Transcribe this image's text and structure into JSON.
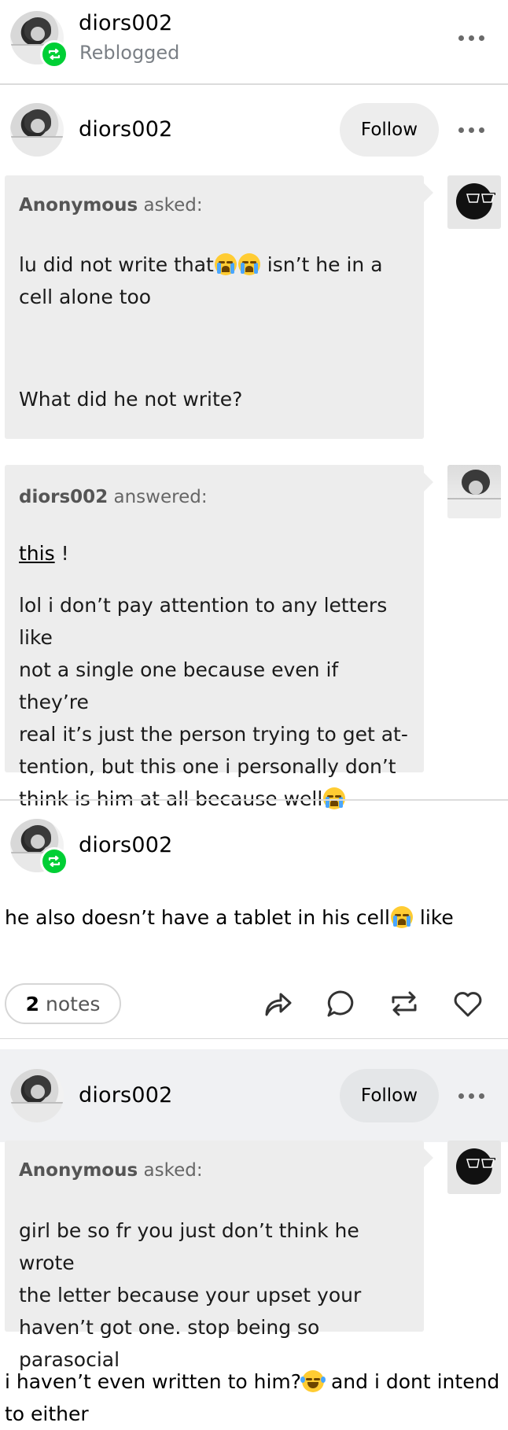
{
  "reblog_header": {
    "username": "diors002",
    "status": "Reblogged"
  },
  "post1": {
    "username": "diors002",
    "follow_label": "Follow",
    "ask": {
      "asker": "Anonymous",
      "asked_label": "asked:",
      "question_line1": "lu did not write that",
      "question_line1_after": "isn’t he in a",
      "question_line2": "cell alone too",
      "followup": "What did he not write?"
    },
    "answer": {
      "answerer": "diors002",
      "answered_label": "answered:",
      "link_text": "this",
      "link_after": " !",
      "body_lines": [
        "lol i don’t pay attention to any letters like",
        "not a single one because even if they’re",
        "real it’s just the person trying to get at-",
        "tention, but this one i personally don’t",
        "think is him at all because well"
      ]
    }
  },
  "post2": {
    "username": "diors002",
    "text": "he also doesn’t have a tablet in his cell",
    "text_after": " like"
  },
  "footer": {
    "notes_count": "2",
    "notes_label": "notes",
    "actions": [
      "share-icon",
      "reply-icon",
      "reblog-icon",
      "like-icon"
    ]
  },
  "post3": {
    "username": "diors002",
    "follow_label": "Follow",
    "ask": {
      "asker": "Anonymous",
      "asked_label": "asked:",
      "lines": [
        "girl be so fr you just don’t think he wrote",
        "the letter because your upset your",
        "haven’t got one. stop being so parasocial"
      ]
    },
    "reply_line1": "i haven’t even written to him?",
    "reply_line1_after": " and i dont intend",
    "reply_line2": "to either"
  },
  "colors": {
    "reblog_green": "#00cf35",
    "bubble_bg": "#ededed",
    "follow_bg": "#ededed",
    "shaded_bg": "#f0f1f3"
  }
}
